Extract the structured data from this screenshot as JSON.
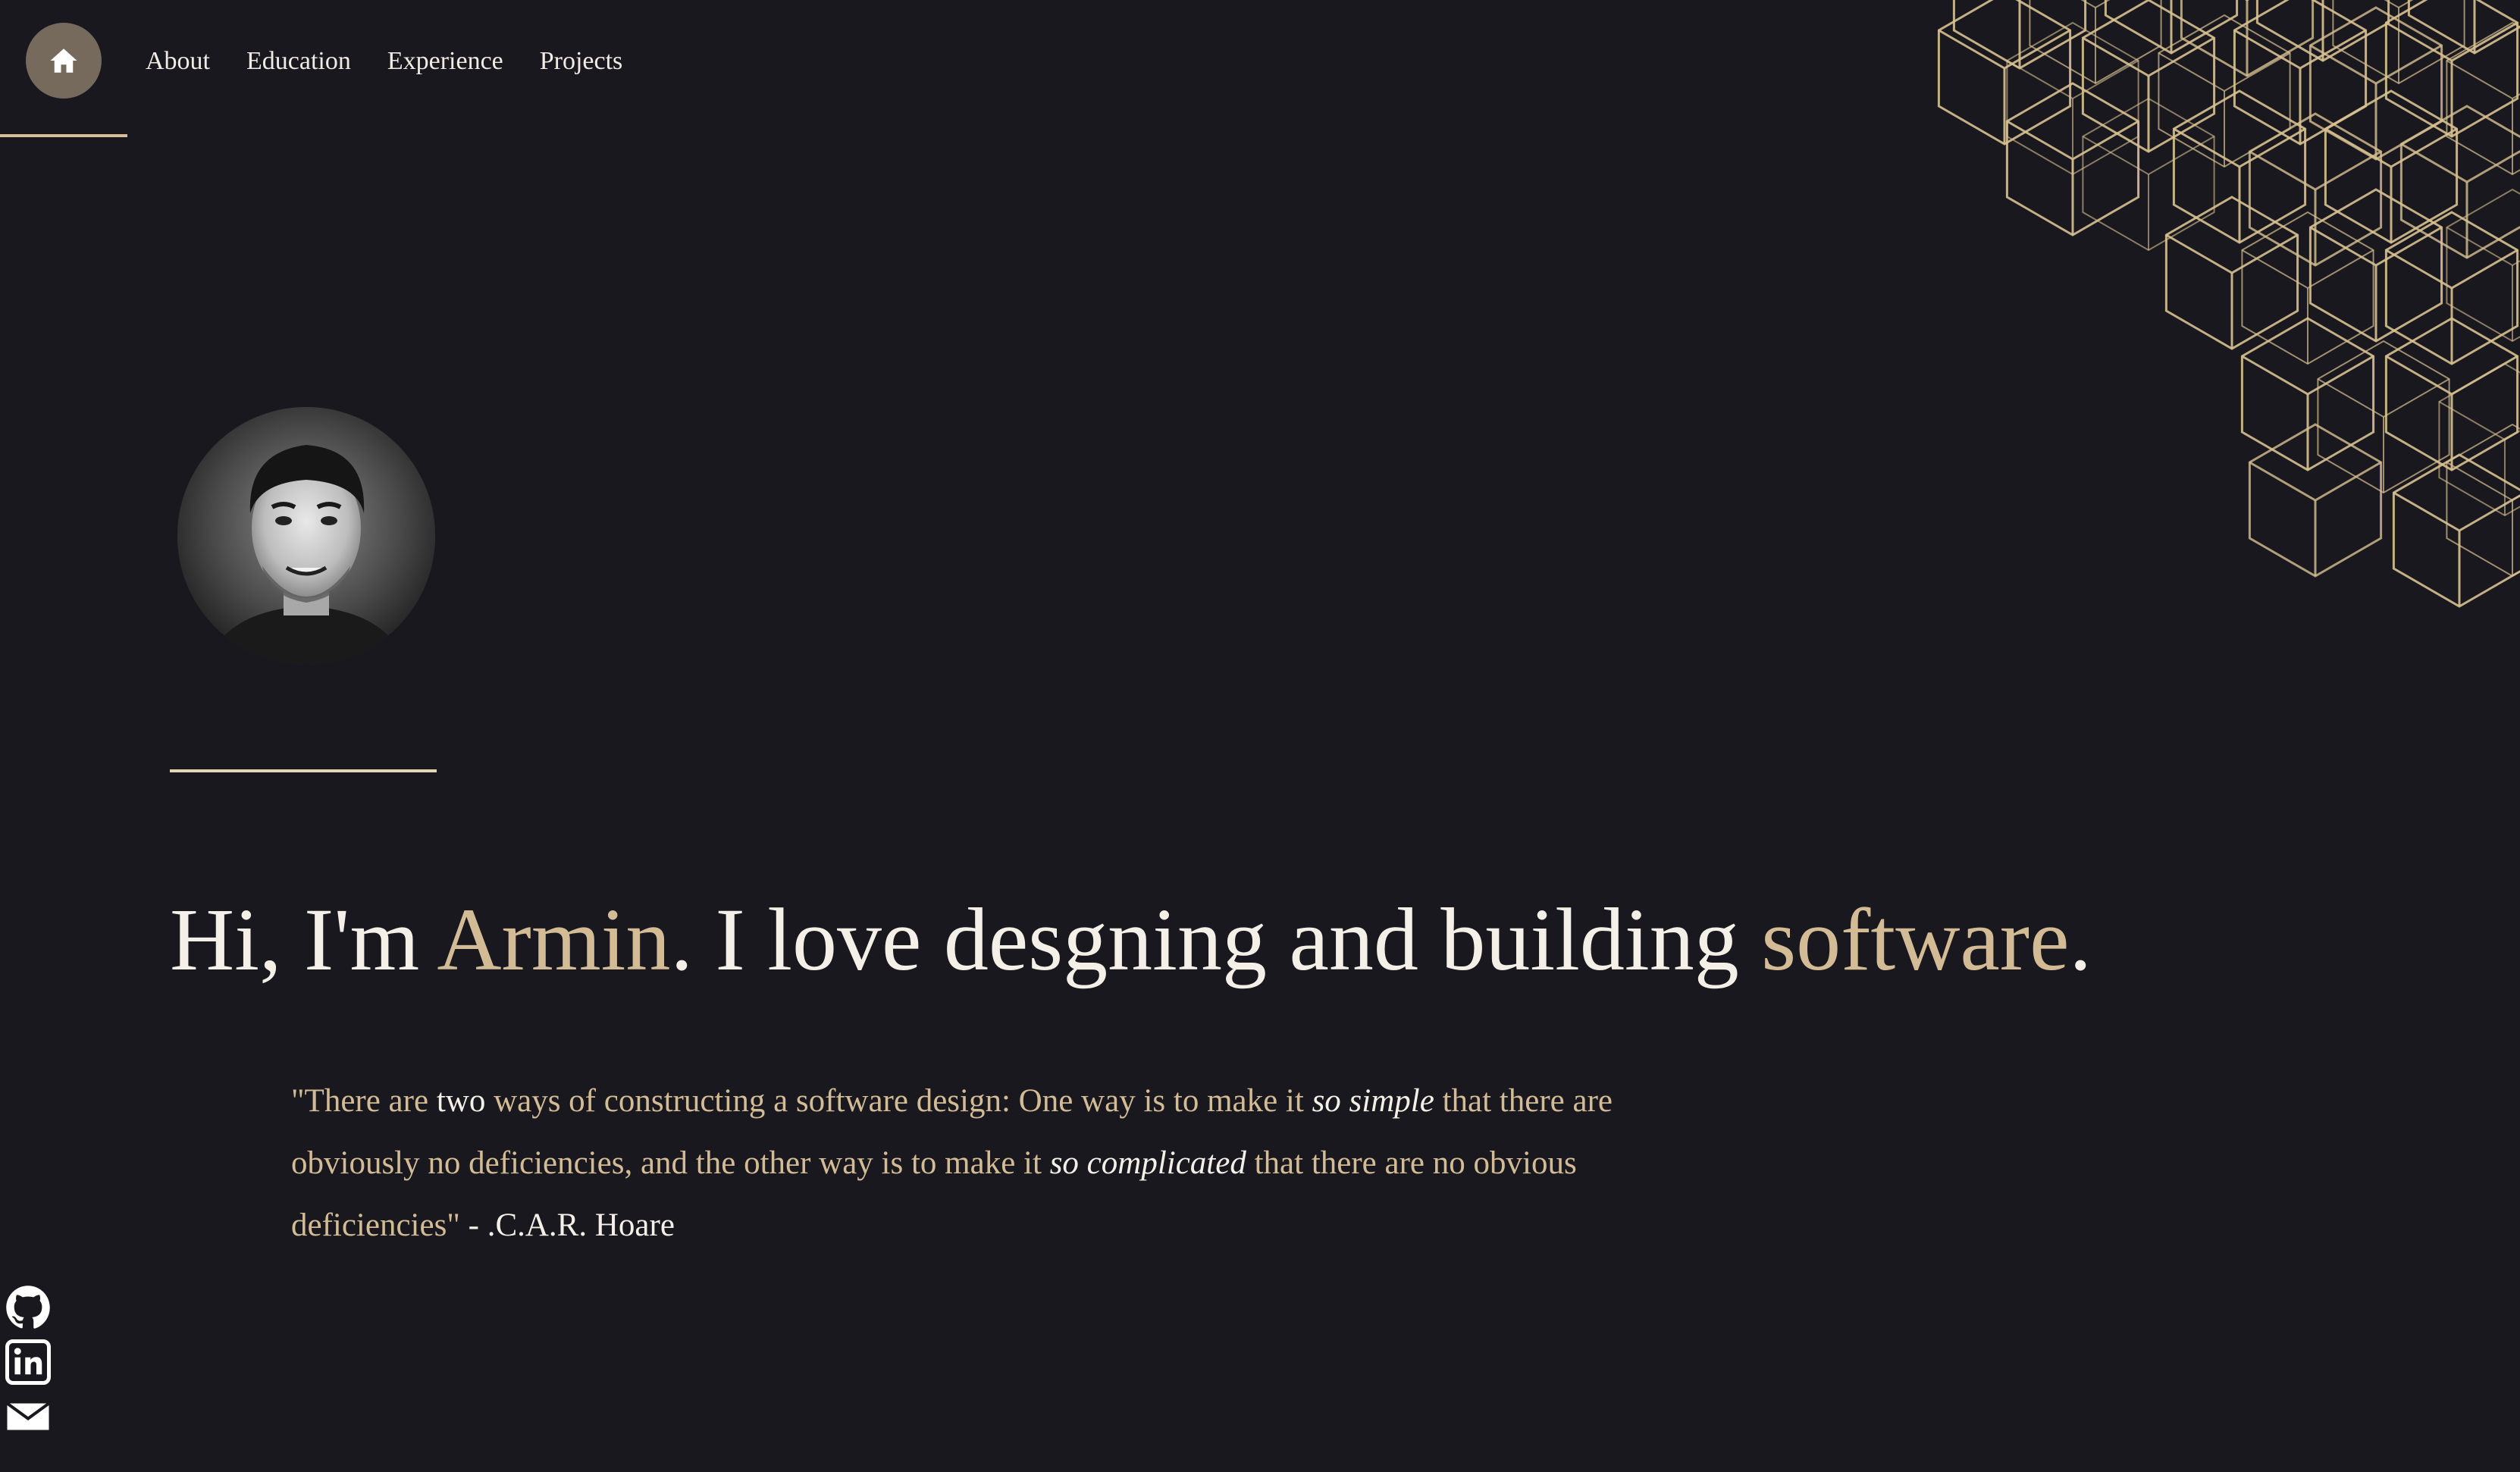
{
  "nav": {
    "home_icon": "home-icon",
    "links": [
      "About",
      "Education",
      "Experience",
      "Projects"
    ]
  },
  "hero": {
    "greeting": "Hi, I'm ",
    "name": "Armin",
    "middle": ". I love desgning and building ",
    "highlight": "software",
    "end": "."
  },
  "quote": {
    "part1": "\"There are ",
    "part2": "two",
    "part3": " ways of constructing a software design: One way is to make it ",
    "em1": "so simple",
    "part4": " that there are obviously no deficiencies, and the other way is to make it ",
    "em2": "so complicated",
    "part5": " that there are no obvious deficiencies\"",
    "attribution": " - .C.A.R. Hoare"
  },
  "social": {
    "icons": [
      "github-icon",
      "linkedin-icon",
      "email-icon"
    ]
  },
  "colors": {
    "background": "#18181e",
    "accent": "#d3bc95",
    "text": "#f4f0e8",
    "home_button": "#756a5c"
  }
}
